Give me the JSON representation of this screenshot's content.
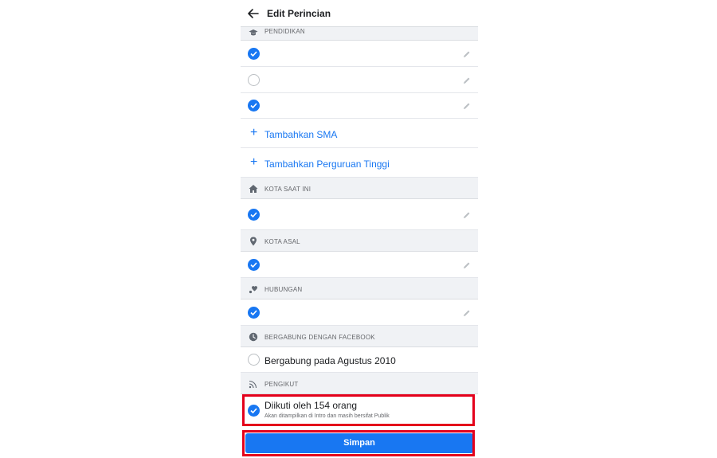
{
  "header": {
    "title": "Edit Perincian"
  },
  "sections": {
    "education": "PENDIDIKAN",
    "current_city": "KOTA SAAT INI",
    "hometown": "KOTA ASAL",
    "relationship": "HUBUNGAN",
    "joined": "BERGABUNG DENGAN FACEBOOK",
    "followers": "PENGIKUT"
  },
  "education": {
    "add_high_school": "Tambahkan SMA",
    "add_college": "Tambahkan Perguruan Tinggi"
  },
  "joined": {
    "label": "Bergabung pada Agustus 2010"
  },
  "followers": {
    "label": "Diikuti oleh 154 orang",
    "note": "Akan ditampilkan di Intro dan masih bersifat Publik"
  },
  "actions": {
    "save_label": "Simpan"
  },
  "colors": {
    "accent": "#1877f2",
    "highlight": "#e4001b",
    "section_bg": "#f0f2f5"
  }
}
